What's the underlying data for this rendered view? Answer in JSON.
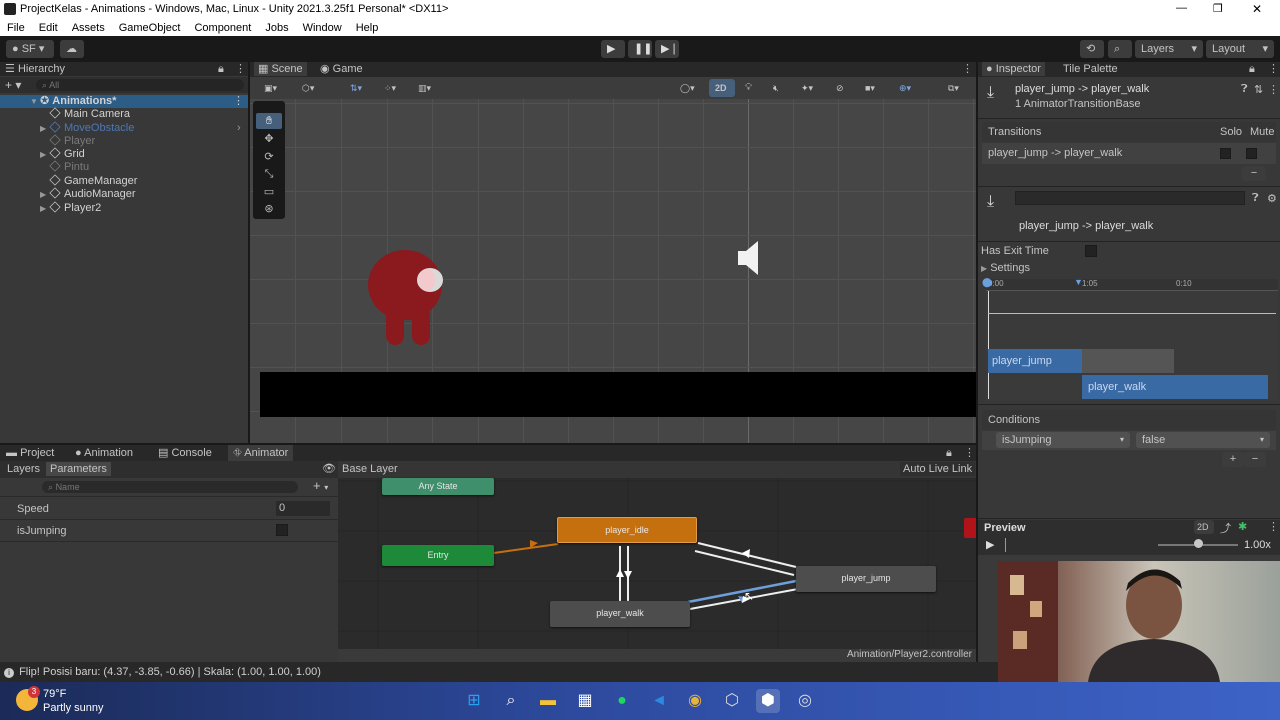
{
  "window": {
    "title": "ProjectKelas - Animations - Windows, Mac, Linux - Unity 2021.3.25f1 Personal* <DX11>",
    "controls": [
      "—",
      "❐",
      "✕"
    ]
  },
  "menu": [
    "File",
    "Edit",
    "Assets",
    "GameObject",
    "Component",
    "Jobs",
    "Window",
    "Help"
  ],
  "toolbar": {
    "account": "SF",
    "layers": "Layers",
    "layout": "Layout"
  },
  "hierarchy": {
    "tab": "Hierarchy",
    "search_placeholder": "All",
    "scene": "Animations*",
    "items": [
      {
        "label": "Main Camera",
        "color": "#d2d2d2"
      },
      {
        "label": "MoveObstacle",
        "color": "#4d77b5"
      },
      {
        "label": "Player",
        "color": "#7a7a7a"
      },
      {
        "label": "Grid",
        "color": "#d2d2d2"
      },
      {
        "label": "Pintu",
        "color": "#7a7a7a"
      },
      {
        "label": "GameManager",
        "color": "#d2d2d2"
      },
      {
        "label": "AudioManager",
        "color": "#d2d2d2"
      },
      {
        "label": "Player2",
        "color": "#d2d2d2"
      }
    ]
  },
  "scene_view": {
    "tabs": [
      "Scene",
      "Game"
    ],
    "mode_2d": "2D"
  },
  "inspector": {
    "tabs": [
      "Inspector",
      "Tile Palette"
    ],
    "object_title": "player_jump -> player_walk",
    "object_subtitle": "1 AnimatorTransitionBase",
    "transitions_label": "Transitions",
    "solo_label": "Solo",
    "mute_label": "Mute",
    "transition_row": "player_jump -> player_walk",
    "transition_name": "player_jump -> player_walk",
    "has_exit_time": "Has Exit Time",
    "settings": "Settings",
    "timeline_ticks": [
      "0:00",
      "1:05",
      "0:10"
    ],
    "clip_from": "player_jump",
    "clip_to": "player_walk",
    "conditions_label": "Conditions",
    "condition_param": "isJumping",
    "condition_value": "false",
    "preview_label": "Preview",
    "preview_2d": "2D",
    "preview_speed": "1.00x"
  },
  "bottom_tabs": [
    "Project",
    "Animation",
    "Console",
    "Animator"
  ],
  "animator": {
    "subtabs": [
      "Layers",
      "Parameters"
    ],
    "search_placeholder": "Name",
    "params": [
      {
        "name": "Speed",
        "value": "0"
      },
      {
        "name": "isJumping",
        "value": ""
      }
    ],
    "layer": "Base Layer",
    "auto_live_link": "Auto Live Link",
    "states": {
      "any": "Any State",
      "entry": "Entry",
      "idle": "player_idle",
      "walk": "player_walk",
      "jump": "player_jump"
    },
    "controller_path": "Animation/Player2.controller"
  },
  "status": "Flip! Posisi baru: (4.37, -3.85, -0.66) | Skala: (1.00, 1.00, 1.00)",
  "weather": {
    "temp": "79°F",
    "desc": "Partly sunny",
    "badge": "3"
  },
  "colors": {
    "accent": "#3a79bb",
    "idle_node": "#c5700f",
    "entry_node": "#1d8a3a",
    "any_state_node": "#3f8f6c",
    "character": "#8b1a1f"
  }
}
